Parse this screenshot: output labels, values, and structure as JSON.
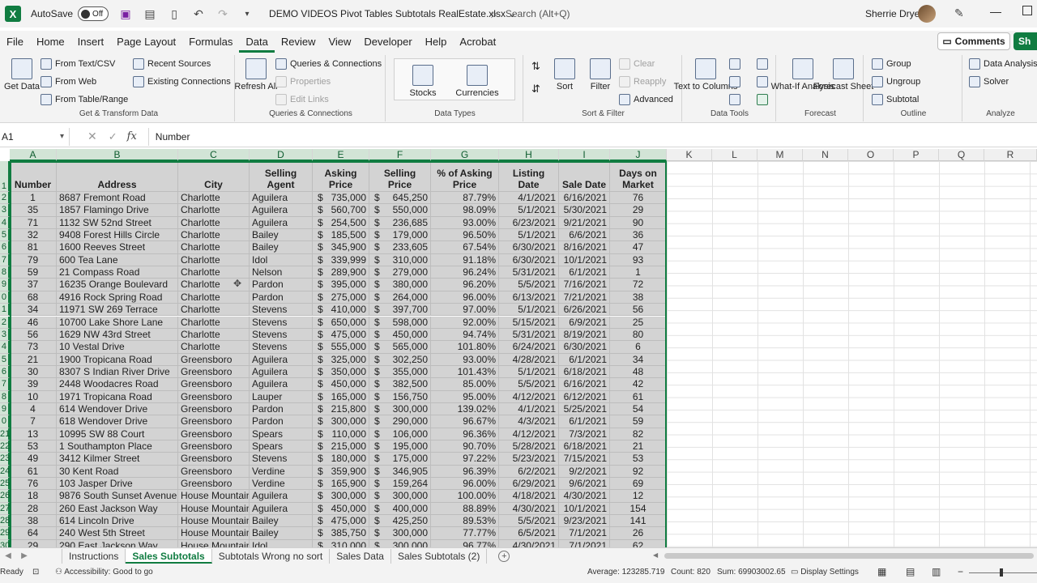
{
  "titlebar": {
    "app_icon": "X",
    "autosave_label": "AutoSave",
    "autosave_state": "Off",
    "filename": "DEMO VIDEOS Pivot Tables Subtotals RealEstate.xlsx",
    "search_placeholder": "Search (Alt+Q)",
    "user_name": "Sherrie Drye"
  },
  "menu": {
    "tabs": [
      "File",
      "Home",
      "Insert",
      "Page Layout",
      "Formulas",
      "Data",
      "Review",
      "View",
      "Developer",
      "Help",
      "Acrobat"
    ],
    "active_tab": "Data",
    "comments_label": "Comments",
    "share_label": "Sh"
  },
  "ribbon": {
    "get_transform": {
      "label": "Get & Transform Data",
      "get_data": "Get Data",
      "from_text_csv": "From Text/CSV",
      "from_web": "From Web",
      "from_table_range": "From Table/Range",
      "recent_sources": "Recent Sources",
      "existing_connections": "Existing Connections"
    },
    "queries": {
      "label": "Queries & Connections",
      "refresh_all": "Refresh All",
      "queries_connections": "Queries & Connections",
      "properties": "Properties",
      "edit_links": "Edit Links"
    },
    "data_types": {
      "label": "Data Types",
      "stocks": "Stocks",
      "currencies": "Currencies"
    },
    "sort_filter": {
      "label": "Sort & Filter",
      "sort": "Sort",
      "filter": "Filter",
      "clear": "Clear",
      "reapply": "Reapply",
      "advanced": "Advanced"
    },
    "data_tools": {
      "label": "Data Tools",
      "text_to_columns": "Text to Columns"
    },
    "forecast": {
      "label": "Forecast",
      "what_if": "What-If Analysis",
      "forecast_sheet": "Forecast Sheet"
    },
    "outline": {
      "label": "Outline",
      "group": "Group",
      "ungroup": "Ungroup",
      "subtotal": "Subtotal"
    },
    "analyze": {
      "label": "Analyze",
      "data_analysis": "Data Analysis",
      "solver": "Solver"
    }
  },
  "formula_bar": {
    "name_box": "A1",
    "fx": "fx",
    "content": "Number"
  },
  "grid": {
    "column_letters": [
      "A",
      "B",
      "C",
      "D",
      "E",
      "F",
      "G",
      "H",
      "I",
      "J",
      "K",
      "L",
      "M",
      "N",
      "O",
      "P",
      "Q",
      "R"
    ],
    "row_numbers": [
      "1",
      "2",
      "3",
      "4",
      "5",
      "6",
      "7",
      "8",
      "9",
      "0",
      "1",
      "2",
      "3",
      "4",
      "5",
      "6",
      "7",
      "8",
      "9",
      "0",
      "21",
      "22",
      "23",
      "24",
      "25",
      "26",
      "27",
      "28",
      "29",
      "30"
    ],
    "headers": [
      "Number",
      "Address",
      "City",
      "Selling Agent",
      "Asking Price",
      "Selling Price",
      "% of Asking Price",
      "Listing Date",
      "Sale Date",
      "Days on Market"
    ],
    "rows": [
      [
        "1",
        "8687 Fremont Road",
        "Charlotte",
        "Aguilera",
        "735,000",
        "645,250",
        "87.79%",
        "4/1/2021",
        "6/16/2021",
        "76"
      ],
      [
        "35",
        "1857 Flamingo Drive",
        "Charlotte",
        "Aguilera",
        "560,700",
        "550,000",
        "98.09%",
        "5/1/2021",
        "5/30/2021",
        "29"
      ],
      [
        "71",
        "1132 SW 52nd Street",
        "Charlotte",
        "Aguilera",
        "254,500",
        "236,685",
        "93.00%",
        "6/23/2021",
        "9/21/2021",
        "90"
      ],
      [
        "32",
        "9408 Forest Hills Circle",
        "Charlotte",
        "Bailey",
        "185,500",
        "179,000",
        "96.50%",
        "5/1/2021",
        "6/6/2021",
        "36"
      ],
      [
        "81",
        "1600 Reeves Street",
        "Charlotte",
        "Bailey",
        "345,900",
        "233,605",
        "67.54%",
        "6/30/2021",
        "8/16/2021",
        "47"
      ],
      [
        "79",
        "600 Tea Lane",
        "Charlotte",
        "Idol",
        "339,999",
        "310,000",
        "91.18%",
        "6/30/2021",
        "10/1/2021",
        "93"
      ],
      [
        "59",
        "21 Compass Road",
        "Charlotte",
        "Nelson",
        "289,900",
        "279,000",
        "96.24%",
        "5/31/2021",
        "6/1/2021",
        "1"
      ],
      [
        "37",
        "16235 Orange Boulevard",
        "Charlotte",
        "Pardon",
        "395,000",
        "380,000",
        "96.20%",
        "5/5/2021",
        "7/16/2021",
        "72"
      ],
      [
        "68",
        "4916 Rock Spring Road",
        "Charlotte",
        "Pardon",
        "275,000",
        "264,000",
        "96.00%",
        "6/13/2021",
        "7/21/2021",
        "38"
      ],
      [
        "34",
        "11971 SW 269 Terrace",
        "Charlotte",
        "Stevens",
        "410,000",
        "397,700",
        "97.00%",
        "5/1/2021",
        "6/26/2021",
        "56"
      ],
      [
        "46",
        "10700 Lake Shore Lane",
        "Charlotte",
        "Stevens",
        "650,000",
        "598,000",
        "92.00%",
        "5/15/2021",
        "6/9/2021",
        "25"
      ],
      [
        "56",
        "1629 NW 43rd Street",
        "Charlotte",
        "Stevens",
        "475,000",
        "450,000",
        "94.74%",
        "5/31/2021",
        "8/19/2021",
        "80"
      ],
      [
        "73",
        "10 Vestal Drive",
        "Charlotte",
        "Stevens",
        "555,000",
        "565,000",
        "101.80%",
        "6/24/2021",
        "6/30/2021",
        "6"
      ],
      [
        "21",
        "1900 Tropicana Road",
        "Greensboro",
        "Aguilera",
        "325,000",
        "302,250",
        "93.00%",
        "4/28/2021",
        "6/1/2021",
        "34"
      ],
      [
        "30",
        "8307 S Indian River Drive",
        "Greensboro",
        "Aguilera",
        "350,000",
        "355,000",
        "101.43%",
        "5/1/2021",
        "6/18/2021",
        "48"
      ],
      [
        "39",
        "2448 Woodacres Road",
        "Greensboro",
        "Aguilera",
        "450,000",
        "382,500",
        "85.00%",
        "5/5/2021",
        "6/16/2021",
        "42"
      ],
      [
        "10",
        "1971 Tropicana Road",
        "Greensboro",
        "Lauper",
        "165,000",
        "156,750",
        "95.00%",
        "4/12/2021",
        "6/12/2021",
        "61"
      ],
      [
        "4",
        "614 Wendover Drive",
        "Greensboro",
        "Pardon",
        "215,800",
        "300,000",
        "139.02%",
        "4/1/2021",
        "5/25/2021",
        "54"
      ],
      [
        "7",
        "618 Wendover Drive",
        "Greensboro",
        "Pardon",
        "300,000",
        "290,000",
        "96.67%",
        "4/3/2021",
        "6/1/2021",
        "59"
      ],
      [
        "13",
        "10995 SW 88 Court",
        "Greensboro",
        "Spears",
        "110,000",
        "106,000",
        "96.36%",
        "4/12/2021",
        "7/3/2021",
        "82"
      ],
      [
        "53",
        "1 Southampton Place",
        "Greensboro",
        "Spears",
        "215,000",
        "195,000",
        "90.70%",
        "5/28/2021",
        "6/18/2021",
        "21"
      ],
      [
        "49",
        "3412 Kilmer Street",
        "Greensboro",
        "Stevens",
        "180,000",
        "175,000",
        "97.22%",
        "5/23/2021",
        "7/15/2021",
        "53"
      ],
      [
        "61",
        "30 Kent Road",
        "Greensboro",
        "Verdine",
        "359,900",
        "346,905",
        "96.39%",
        "6/2/2021",
        "9/2/2021",
        "92"
      ],
      [
        "76",
        "103 Jasper Drive",
        "Greensboro",
        "Verdine",
        "165,900",
        "159,264",
        "96.00%",
        "6/29/2021",
        "9/6/2021",
        "69"
      ],
      [
        "18",
        "9876 South Sunset Avenue",
        "House Mountain",
        "Aguilera",
        "300,000",
        "300,000",
        "100.00%",
        "4/18/2021",
        "4/30/2021",
        "12"
      ],
      [
        "28",
        "260 East Jackson Way",
        "House Mountain",
        "Aguilera",
        "450,000",
        "400,000",
        "88.89%",
        "4/30/2021",
        "10/1/2021",
        "154"
      ],
      [
        "38",
        "614 Lincoln Drive",
        "House Mountain",
        "Bailey",
        "475,000",
        "425,250",
        "89.53%",
        "5/5/2021",
        "9/23/2021",
        "141"
      ],
      [
        "64",
        "240 West 5th Street",
        "House Mountain",
        "Bailey",
        "385,750",
        "300,000",
        "77.77%",
        "6/5/2021",
        "7/1/2021",
        "26"
      ],
      [
        "29",
        "290 East Jackson Way",
        "House Mountain",
        "Idol",
        "310,000",
        "300,000",
        "96.77%",
        "4/30/2021",
        "7/1/2021",
        "62"
      ]
    ],
    "currency_symbol": "$"
  },
  "sheets": {
    "tabs": [
      "Instructions",
      "Sales Subtotals",
      "Subtotals Wrong no sort",
      "Sales Data",
      "Sales Subtotals (2)"
    ],
    "active": "Sales Subtotals"
  },
  "status": {
    "mode": "Ready",
    "accessibility": "Accessibility: Good to go",
    "average": "Average: 123285.719",
    "count": "Count: 820",
    "sum": "Sum: 69903002.65",
    "display_settings": "Display Settings"
  },
  "colors": {
    "accent": "#107c41",
    "selection_fill": "#d3d3d3"
  }
}
